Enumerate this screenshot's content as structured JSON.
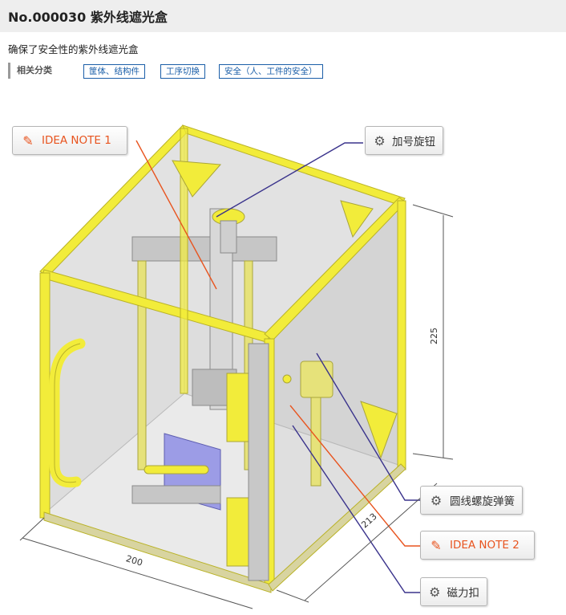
{
  "page": {
    "title": "No.000030 紫外线遮光盒",
    "subtitle": "确保了安全性的紫外线遮光盒",
    "category_label": "相关分类",
    "tags": [
      "筐体、结构件",
      "工序切换",
      "安全（人、工件的安全）"
    ]
  },
  "callouts": {
    "idea_note_1": {
      "label": "IDEA NOTE 1",
      "icon": "pencil-icon"
    },
    "knob": {
      "label": "加号旋钮",
      "icon": "gear-icon"
    },
    "spring": {
      "label": "圆线螺旋弹簧",
      "icon": "gear-icon"
    },
    "idea_note_2": {
      "label": "IDEA NOTE 2",
      "icon": "pencil-icon"
    },
    "magnet": {
      "label": "磁力扣",
      "icon": "gear-icon"
    }
  },
  "dimensions": {
    "height": "225",
    "depth": "213",
    "width": "200"
  },
  "colors": {
    "frame": "#f2ec3a",
    "frame_edge": "#b9b227",
    "panel": "#c8c8c8",
    "idea_line": "#e8541f",
    "part_line": "#3a338c",
    "tag_blue": "#1a5ea8"
  }
}
